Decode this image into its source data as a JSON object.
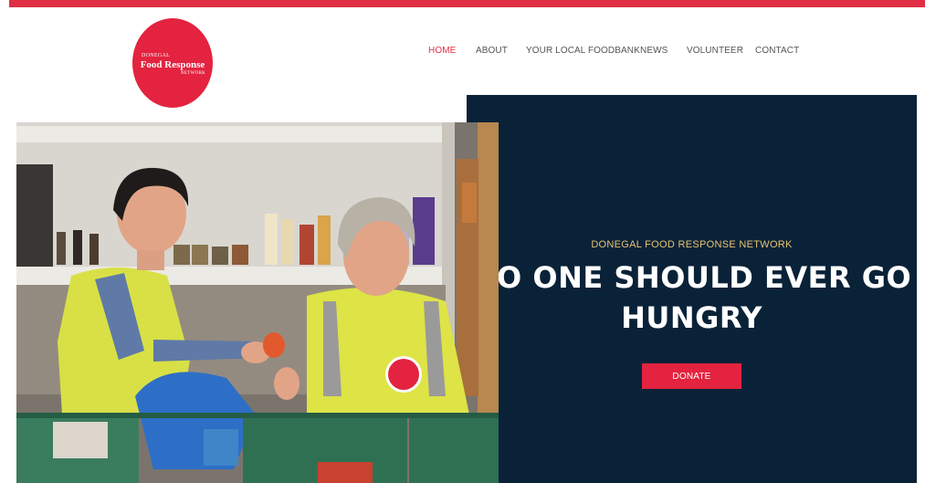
{
  "logo": {
    "line1": "DONEGAL",
    "line2": "Food Response",
    "line3": "NETWORK"
  },
  "nav": {
    "items": [
      {
        "label": "HOME",
        "active": true
      },
      {
        "label": "ABOUT",
        "active": false
      },
      {
        "label": "YOUR LOCAL FOODBANK",
        "active": false
      },
      {
        "label": "NEWS",
        "active": false
      },
      {
        "label": "VOLUNTEER",
        "active": false
      },
      {
        "label": "CONTACT",
        "active": false
      }
    ]
  },
  "hero": {
    "subtitle": "DONEGAL FOOD RESPONSE NETWORK",
    "title": "NO ONE SHOULD EVER GO HUNGRY",
    "donate_label": "DONATE"
  },
  "colors": {
    "brand_red": "#e3233f",
    "navy": "#0a2238",
    "gold": "#e8c372"
  }
}
